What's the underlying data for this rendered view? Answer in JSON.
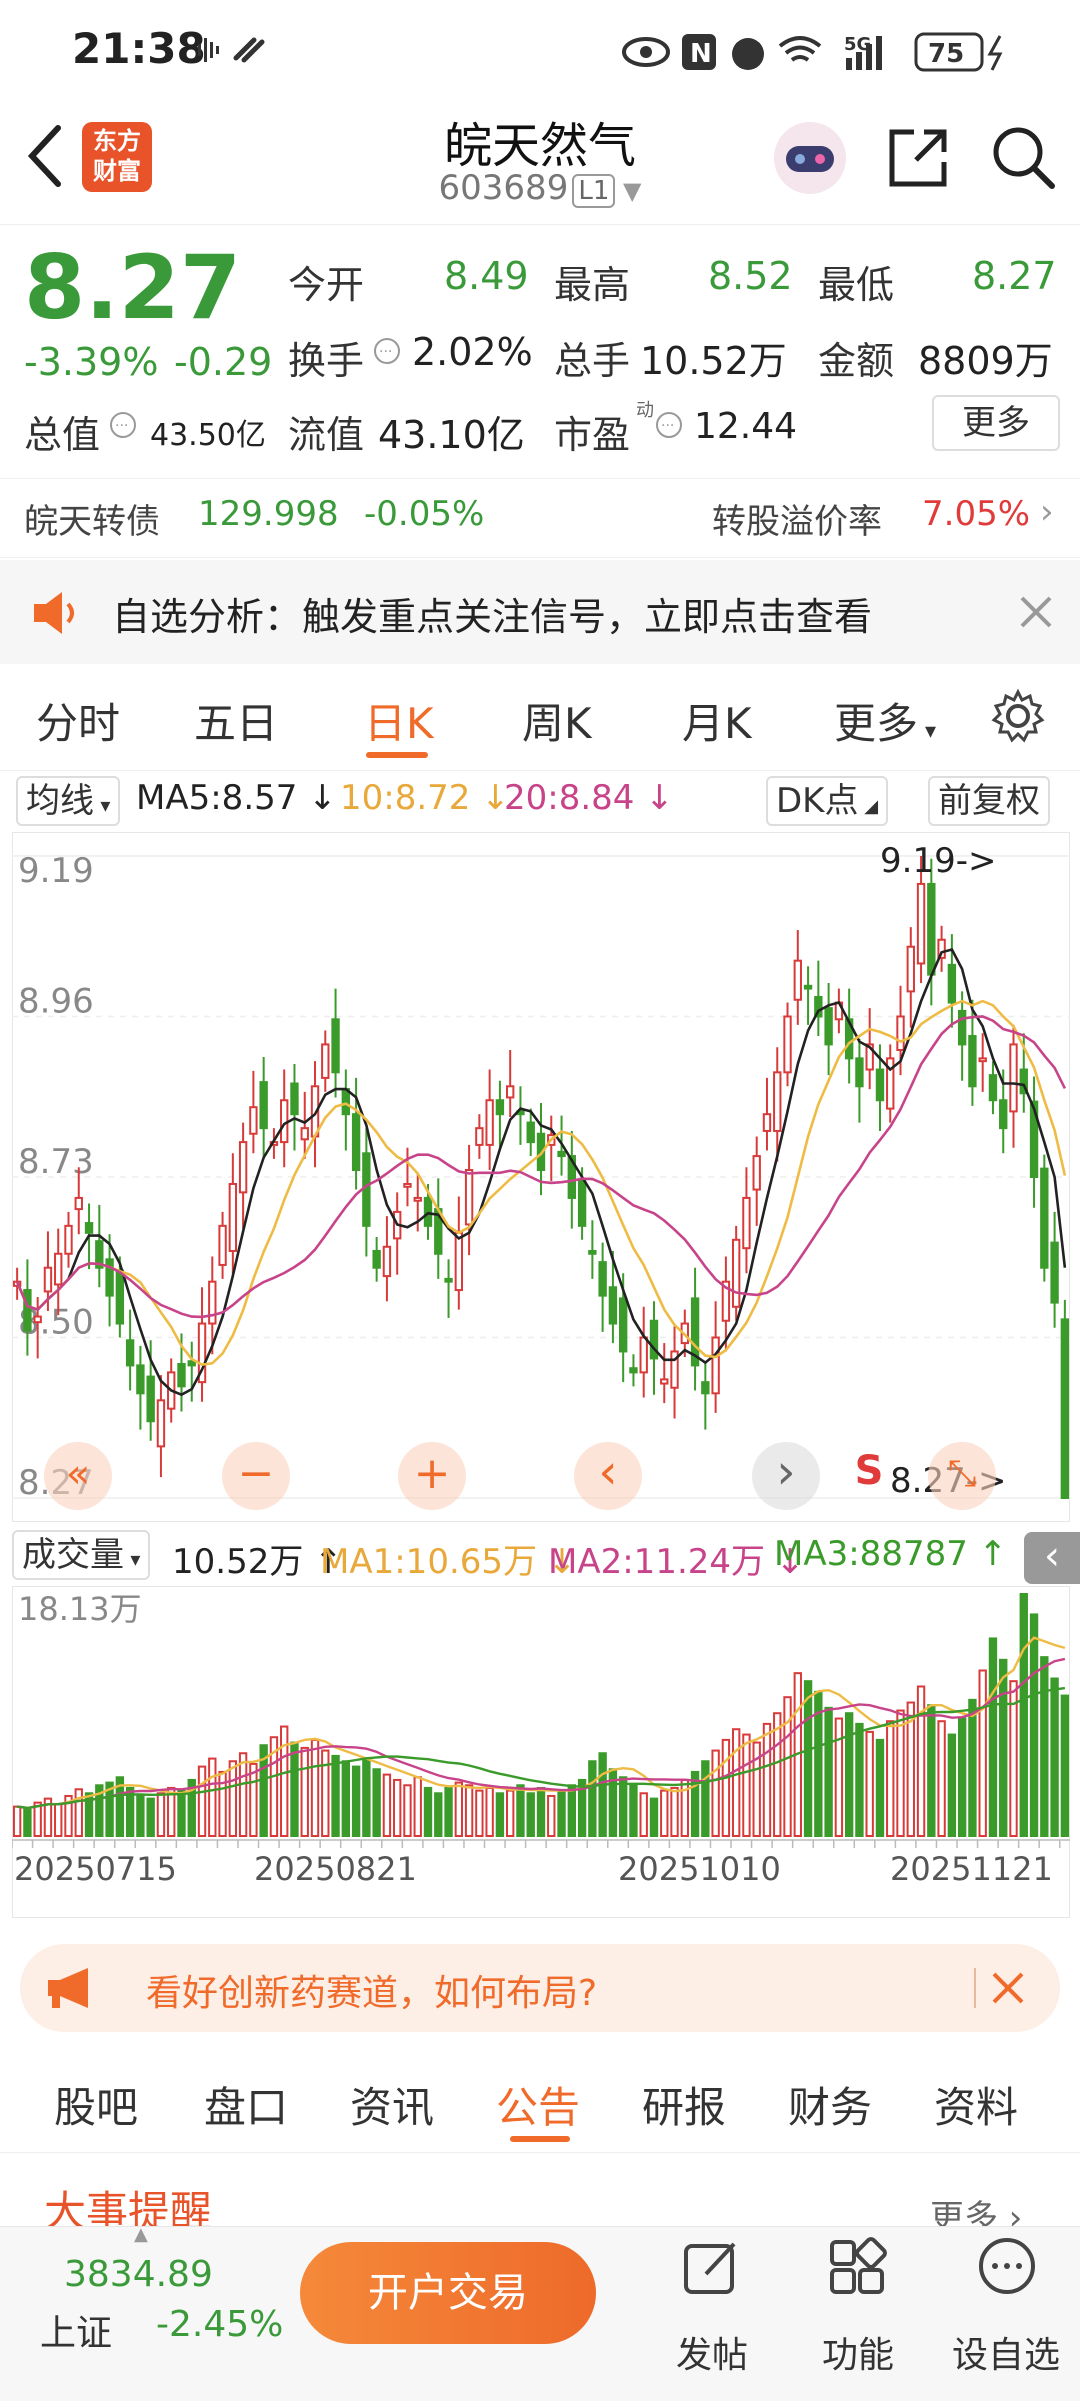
{
  "status": {
    "time": "21:38",
    "battery": "75",
    "network": "5G"
  },
  "header": {
    "back_icon": "chevron-left-icon",
    "brand_logo": "东方\n财富",
    "title": "皖天然气",
    "code": "603689",
    "level": "L1",
    "share_icon": "share-icon",
    "search_icon": "search-icon"
  },
  "quote": {
    "price": "8.27",
    "change_pct": "-3.39%",
    "change": "-0.29",
    "open_label": "今开",
    "open": "8.49",
    "high_label": "最高",
    "high": "8.52",
    "low_label": "最低",
    "low": "8.27",
    "turnover_label": "换手",
    "turnover": "2.02%",
    "volume_label": "总手",
    "volume": "10.52万",
    "amount_label": "金额",
    "amount": "8809万",
    "mktcap_label": "总值",
    "mktcap": "43.50亿",
    "float_label": "流值",
    "float_cap": "43.10亿",
    "pe_label": "市盈",
    "pe_sup": "动",
    "pe": "12.44",
    "more_label": "更多"
  },
  "bond": {
    "name": "皖天转债",
    "price": "129.998",
    "change": "-0.05%",
    "premium_label": "转股溢价率",
    "premium": "7.05%"
  },
  "notice": {
    "text": "自选分析：触发重点关注信号，立即点击查看"
  },
  "tabs": [
    "分时",
    "五日",
    "日K",
    "周K",
    "月K",
    "更多"
  ],
  "active_tab": "日K",
  "ma": {
    "selector": "均线",
    "ma5": "MA5:8.57",
    "ma10": "10:8.72",
    "ma20": "20:8.84",
    "dk": "DK点",
    "adjust": "前复权"
  },
  "chart_controls": [
    "«",
    "−",
    "+",
    "‹",
    "›",
    "S",
    "⤡"
  ],
  "volume_bar": {
    "selector": "成交量",
    "vol": "10.52万",
    "ma1": "MA1:10.65万",
    "ma2": "MA2:11.24万",
    "ma3": "MA3:88787"
  },
  "chart_data": {
    "type": "candlestick",
    "y_ticks": [
      "9.19",
      "8.96",
      "8.73",
      "8.50",
      "8.27"
    ],
    "ylim": [
      8.27,
      9.19
    ],
    "max_marker": "9.19->",
    "min_marker": "8.27->",
    "vol_max_label": "18.13万",
    "x_labels": [
      "20250715",
      "20250821",
      "20251010",
      "20251121"
    ],
    "colors": {
      "up": "#d83a3a",
      "down": "#3a9a2a",
      "ma5": "#222222",
      "ma10": "#eebb44",
      "ma20": "#c8448a"
    },
    "closes": [
      8.58,
      8.51,
      8.53,
      8.6,
      8.62,
      8.66,
      8.7,
      8.65,
      8.6,
      8.56,
      8.52,
      8.46,
      8.42,
      8.38,
      8.41,
      8.45,
      8.43,
      8.46,
      8.52,
      8.58,
      8.66,
      8.72,
      8.78,
      8.83,
      8.8,
      8.78,
      8.84,
      8.82,
      8.8,
      8.86,
      8.92,
      8.88,
      8.82,
      8.74,
      8.66,
      8.6,
      8.63,
      8.68,
      8.72,
      8.7,
      8.66,
      8.62,
      8.58,
      8.65,
      8.74,
      8.8,
      8.84,
      8.82,
      8.86,
      8.82,
      8.78,
      8.74,
      8.79,
      8.76,
      8.7,
      8.66,
      8.62,
      8.56,
      8.52,
      8.48,
      8.45,
      8.5,
      8.47,
      8.44,
      8.48,
      8.52,
      8.46,
      8.42,
      8.5,
      8.58,
      8.64,
      8.7,
      8.76,
      8.82,
      8.88,
      8.96,
      9.04,
      9.0,
      8.96,
      8.92,
      8.98,
      8.9,
      8.86,
      8.92,
      8.84,
      8.9,
      8.96,
      9.06,
      9.15,
      9.02,
      9.07,
      8.98,
      8.92,
      8.86,
      8.9,
      8.84,
      8.8,
      8.92,
      8.85,
      8.73,
      8.6,
      8.55,
      8.27
    ],
    "volumes": [
      2.2,
      2.0,
      2.5,
      2.8,
      2.4,
      3.0,
      3.5,
      3.2,
      3.8,
      4.0,
      4.4,
      3.6,
      3.0,
      2.8,
      3.2,
      3.6,
      3.4,
      4.2,
      5.2,
      5.8,
      4.8,
      5.6,
      6.2,
      5.4,
      6.8,
      7.4,
      8.2,
      7.0,
      6.6,
      7.2,
      6.4,
      6.0,
      5.6,
      5.2,
      5.8,
      5.0,
      4.6,
      4.2,
      3.8,
      4.4,
      3.6,
      3.2,
      3.6,
      4.0,
      3.8,
      3.4,
      3.6,
      3.2,
      3.4,
      3.8,
      3.2,
      3.6,
      3.0,
      3.4,
      3.8,
      4.2,
      5.6,
      6.2,
      5.0,
      4.4,
      3.8,
      3.2,
      2.8,
      3.4,
      3.6,
      4.2,
      4.8,
      5.6,
      6.4,
      7.2,
      8.0,
      7.6,
      7.0,
      8.4,
      9.2,
      10.4,
      12.2,
      11.6,
      10.8,
      9.6,
      8.8,
      9.2,
      8.4,
      7.8,
      7.2,
      8.6,
      9.4,
      10.0,
      11.2,
      9.8,
      8.6,
      7.6,
      8.8,
      10.2,
      12.4,
      14.8,
      13.2,
      11.6,
      18.13,
      16.6,
      13.4,
      11.8,
      10.52
    ]
  },
  "promo": {
    "text": "看好创新药赛道，如何布局?"
  },
  "bottom_tabs": [
    "股吧",
    "盘口",
    "资讯",
    "公告",
    "研报",
    "财务",
    "资料"
  ],
  "bottom_active": "公告",
  "events": {
    "title": "大事提醒",
    "more": "更多"
  },
  "footer": {
    "index_value": "3834.89",
    "index_name": "上证",
    "index_change": "-2.45%",
    "trade_label": "开户交易",
    "post_label": "发帖",
    "func_label": "功能",
    "watch_label": "设自选"
  }
}
